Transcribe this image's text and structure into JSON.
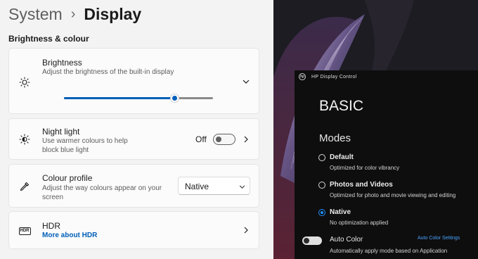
{
  "settings": {
    "breadcrumb": {
      "parent": "System",
      "separator": "›",
      "current": "Display"
    },
    "section_title": "Brightness & colour",
    "brightness": {
      "icon": "sun-icon",
      "title": "Brightness",
      "description": "Adjust the brightness of the built-in display",
      "level_fraction": 0.74,
      "expand_icon": "chevron-down-icon"
    },
    "night_light": {
      "icon": "night-light-icon",
      "title": "Night light",
      "description_line1": "Use warmer colours to help",
      "description_line2": "block blue light",
      "state_label": "Off",
      "on": false,
      "nav_icon": "chevron-right-icon"
    },
    "colour_profile": {
      "icon": "eyedropper-icon",
      "title": "Colour profile",
      "description_line1": "Adjust the way colours appear on your",
      "description_line2": "screen",
      "selected": "Native",
      "dropdown_icon": "chevron-down-icon"
    },
    "hdr": {
      "icon": "hdr-icon",
      "icon_text": "HDR",
      "title": "HDR",
      "link": "More about HDR",
      "nav_icon": "chevron-right-icon"
    },
    "accent_color": "#005fb8"
  },
  "hp_display_control": {
    "logo_icon": "hp-logo-icon",
    "logo_text": "hp",
    "app_title": "HP Display Control",
    "page_title": "BASIC",
    "modes_heading": "Modes",
    "modes": [
      {
        "name": "Default",
        "description": "Optimized for color vibrancy",
        "selected": false
      },
      {
        "name": "Photos and Videos",
        "description": "Optimized for photo and movie viewing and editing",
        "selected": false
      },
      {
        "name": "Native",
        "description": "No optimization applied",
        "selected": true
      }
    ],
    "auto_color": {
      "label": "Auto Color",
      "description": "Automatically apply mode based on Application",
      "settings_link": "Auto Color Settings",
      "on": false
    },
    "accent_color": "#1e90ff"
  }
}
